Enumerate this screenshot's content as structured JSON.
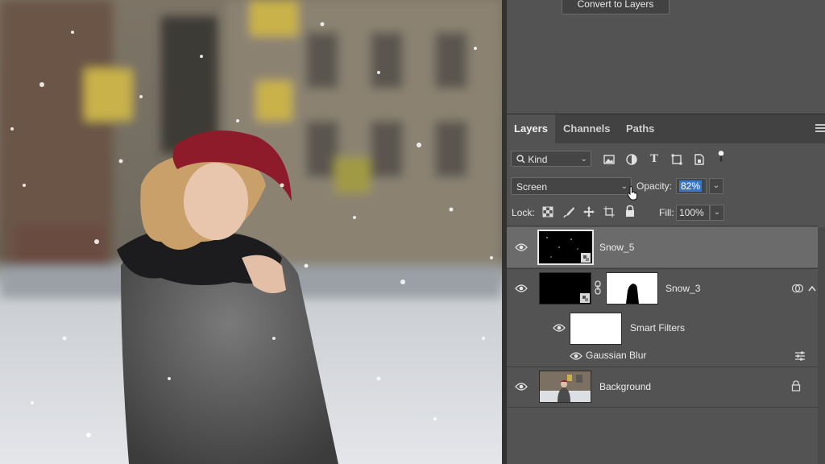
{
  "top": {
    "convert_button": "Convert to Layers"
  },
  "tabs": [
    {
      "label": "Layers",
      "active": true
    },
    {
      "label": "Channels",
      "active": false
    },
    {
      "label": "Paths",
      "active": false
    }
  ],
  "filter": {
    "kind_label": "Kind"
  },
  "blend": {
    "mode": "Screen",
    "opacity_label": "Opacity:",
    "opacity_value": "82%"
  },
  "lock": {
    "label": "Lock:",
    "fill_label": "Fill:",
    "fill_value": "100%"
  },
  "layers": [
    {
      "name": "Snow_5"
    },
    {
      "name": "Snow_3"
    },
    {
      "name": "Smart Filters"
    },
    {
      "name": "Gaussian Blur"
    },
    {
      "name": "Background"
    }
  ],
  "colors": {
    "panel_bg": "#535353",
    "selected_row": "#6b6b6b",
    "highlight": "#3b78c4"
  }
}
